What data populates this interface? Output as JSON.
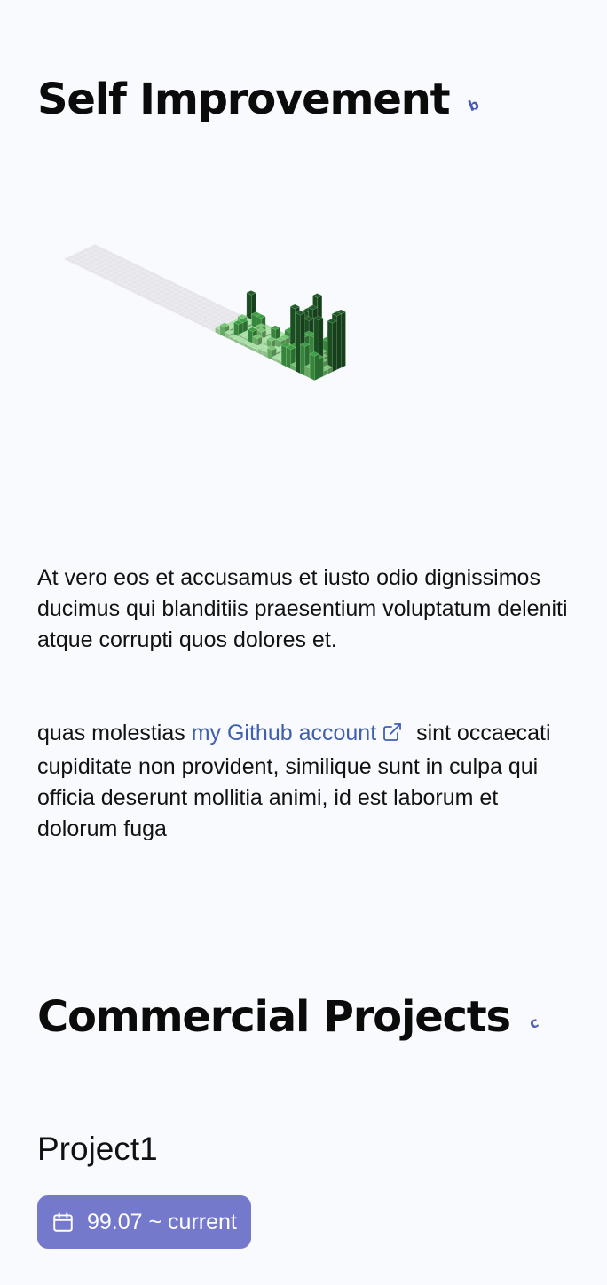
{
  "self_improvement": {
    "title": "Self Improvement",
    "badge": "b",
    "paragraph1": "At vero eos et accusamus et iusto odio dignissimos ducimus qui blanditiis praesentium voluptatum deleniti atque corrupti quos dolores et.",
    "paragraph2_before": "quas molestias ",
    "link_text": "my Github account",
    "paragraph2_after": " sint occaecati cupiditate non provident, similique sunt in culpa qui officia deserunt mollitia animi, id est laborum et dolorum fuga"
  },
  "contribution_graph": {
    "weeks": 53,
    "days": 7,
    "active_from_week": 32,
    "colors": {
      "empty": "#e6e6ea",
      "level1": "#a7e0a4",
      "level2": "#78c774",
      "level3": "#3e9e44",
      "level4": "#1f5c26"
    }
  },
  "commercial": {
    "title": "Commercial Projects",
    "badge": "c",
    "projects": [
      {
        "name": "Project1",
        "period": "99.07 ~ current",
        "icon": "calendar-icon"
      }
    ]
  },
  "colors": {
    "link": "#3f5fb0",
    "badge_bg": "#7479cc",
    "background": "#f9fafd"
  }
}
